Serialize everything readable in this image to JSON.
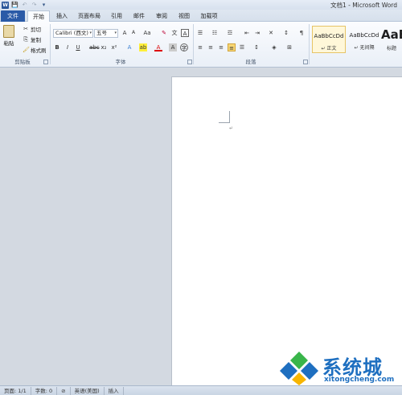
{
  "title": "文档1 - Microsoft Word",
  "quick_access": {
    "save": "💾",
    "undo": "↶",
    "redo": "↷",
    "more": "▾"
  },
  "tabs": [
    {
      "label": "文件"
    },
    {
      "label": "开始"
    },
    {
      "label": "插入"
    },
    {
      "label": "页面布局"
    },
    {
      "label": "引用"
    },
    {
      "label": "邮件"
    },
    {
      "label": "审阅"
    },
    {
      "label": "视图"
    },
    {
      "label": "加载项"
    }
  ],
  "active_tab": "开始",
  "clipboard": {
    "group_label": "剪贴板",
    "paste": "粘贴",
    "cut": "剪切",
    "copy": "复制",
    "format_painter": "格式刷"
  },
  "font": {
    "group_label": "字体",
    "font_name": "Calibri (西文)",
    "font_size": "五号",
    "grow": "A",
    "shrink": "A",
    "change_case": "Aa",
    "clear": "A"
  },
  "paragraph": {
    "group_label": "段落"
  },
  "styles": {
    "items": [
      {
        "sample": "AaBbCcDd",
        "name": "↵ 正文"
      },
      {
        "sample": "AaBbCcDd",
        "name": "↵ 无间隔"
      },
      {
        "sample": "AaB",
        "name": "标题"
      }
    ]
  },
  "status": {
    "page": "页面: 1/1",
    "words": "字数: 0",
    "language": "英语(美国)",
    "mode": "插入"
  },
  "watermark": {
    "title": "系统城",
    "url": "xitongcheng.com"
  },
  "colors": {
    "file_tab": "#2a5aa7",
    "accent": "#1e6fc0"
  }
}
